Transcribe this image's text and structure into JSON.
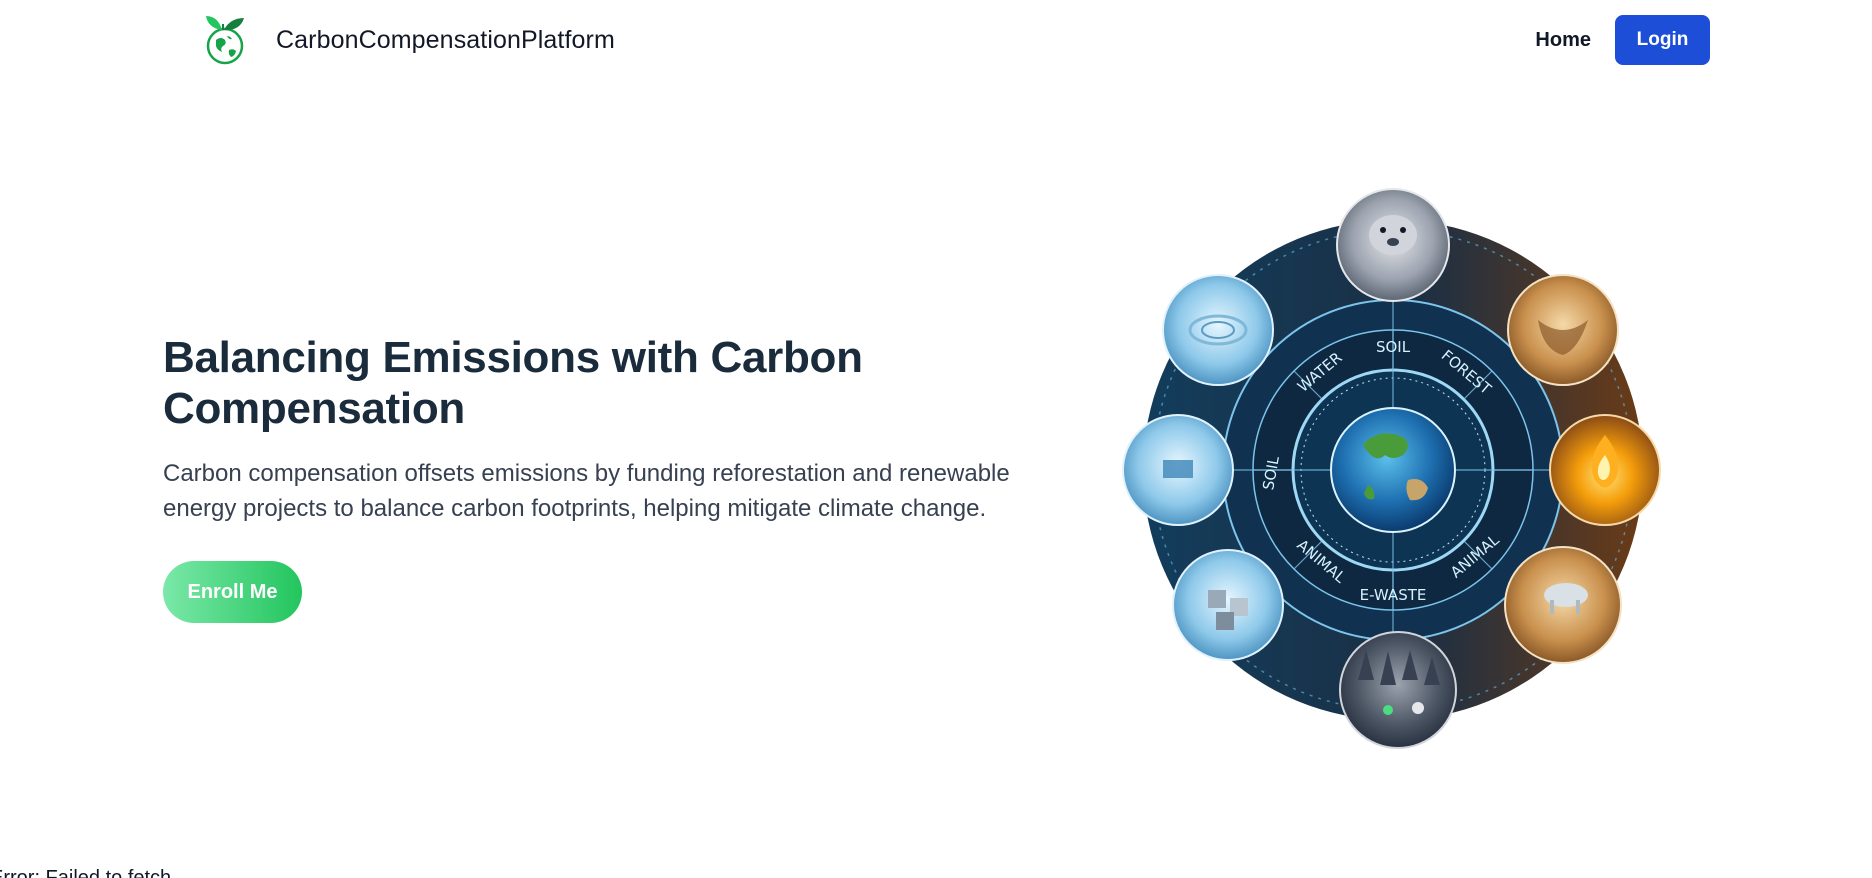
{
  "navbar": {
    "brand_name": "CarbonCompensationPlatform",
    "logo_icon": "leaf-globe-icon",
    "home_label": "Home",
    "login_label": "Login",
    "login_color": "#1d4ed8"
  },
  "hero": {
    "title": "Balancing Emissions with Carbon Compensation",
    "description": "Carbon compensation offsets emissions by funding reforestation and renewable energy projects to balance carbon footprints, helping mitigate climate change.",
    "enroll_label": "Enroll Me",
    "enroll_gradient": [
      "#7be8a8",
      "#22c55e"
    ],
    "image_labels": [
      "SOIL",
      "FOREST",
      "WATER",
      "ANIMAL",
      "E-WASTE",
      "ANIMAL",
      "SOIL"
    ]
  },
  "status": {
    "error_text": "Error: Failed to fetch"
  }
}
